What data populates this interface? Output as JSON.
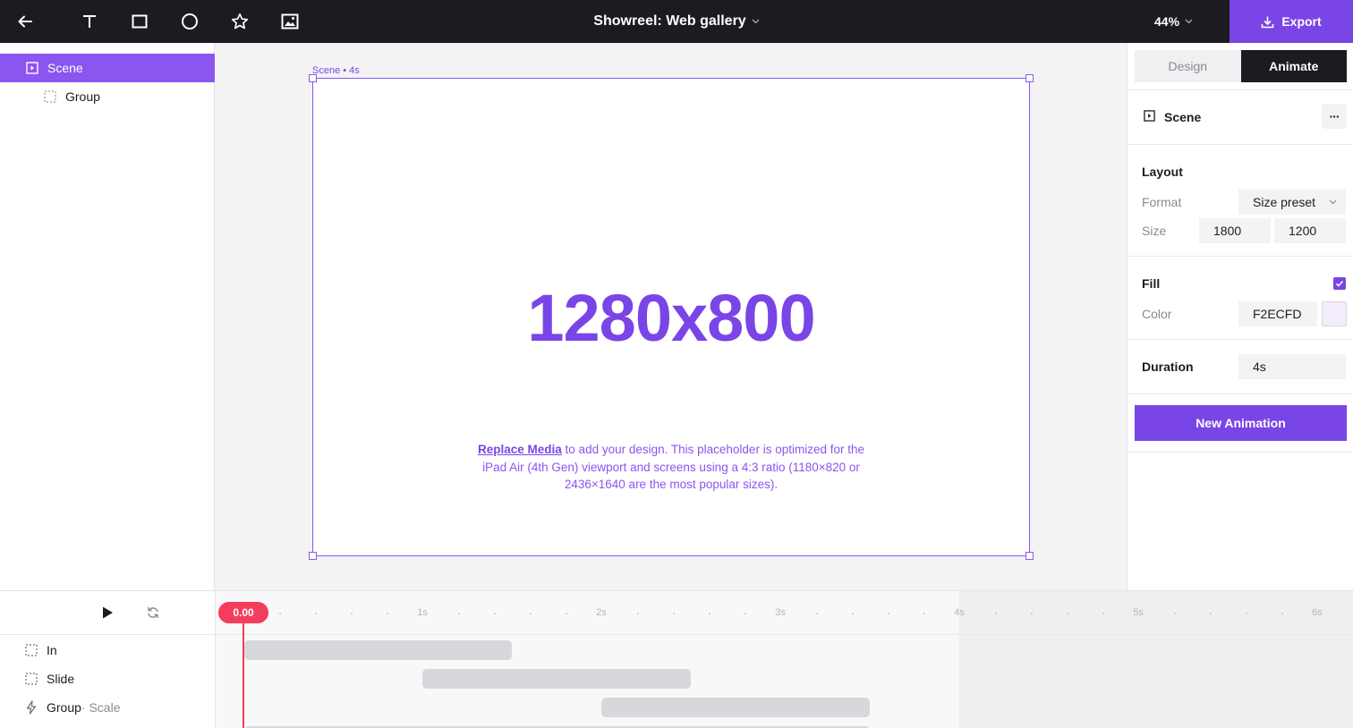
{
  "topbar": {
    "title": "Showreel: Web gallery",
    "zoom": "44%",
    "export_label": "Export",
    "tools": [
      "back-arrow-icon",
      "text-tool-icon",
      "rectangle-tool-icon",
      "ellipse-tool-icon",
      "star-tool-icon",
      "image-tool-icon"
    ]
  },
  "layers": {
    "items": [
      {
        "label": "Scene",
        "icon": "scene-icon",
        "selected": true
      },
      {
        "label": "Group",
        "icon": "group-icon",
        "selected": false
      }
    ]
  },
  "canvas": {
    "scene_label": "Scene • 4s",
    "headline": "1280x800",
    "link_text": "Replace Media",
    "description_rest": " to add your design. This placeholder is optimized for the iPad Air (4th Gen) viewport and screens using a 4:3 ratio (1180×820 or 2436×1640 are the most popular sizes)."
  },
  "inspector": {
    "tabs": [
      "Design",
      "Animate"
    ],
    "active_tab": "Animate",
    "header_label": "Scene",
    "more_label": "···",
    "layout_title": "Layout",
    "format_label": "Format",
    "format_value": "Size preset",
    "size_label": "Size",
    "width": "1800",
    "height": "1200",
    "fill_title": "Fill",
    "fill_enabled": true,
    "color_label": "Color",
    "color_value": "F2ECFD",
    "swatch_color": "#F2ECFD",
    "duration_label": "Duration",
    "duration_value": "4s",
    "new_animation_label": "New Animation"
  },
  "timeline": {
    "playhead": "0.00",
    "ticks": [
      "1s",
      "2s",
      "3s",
      "4s",
      "5s",
      "6s"
    ],
    "tracks": [
      {
        "label": "In",
        "sublabel": "",
        "icon": "dashed-box-icon"
      },
      {
        "label": "Slide",
        "sublabel": "",
        "icon": "dashed-box-icon"
      },
      {
        "label": "Group",
        "sublabel": " · Scale",
        "icon": "lightning-icon"
      }
    ]
  },
  "colors": {
    "accent": "#7A45E6",
    "playhead": "#F33D5C",
    "topbar_bg": "#1C1B20"
  }
}
